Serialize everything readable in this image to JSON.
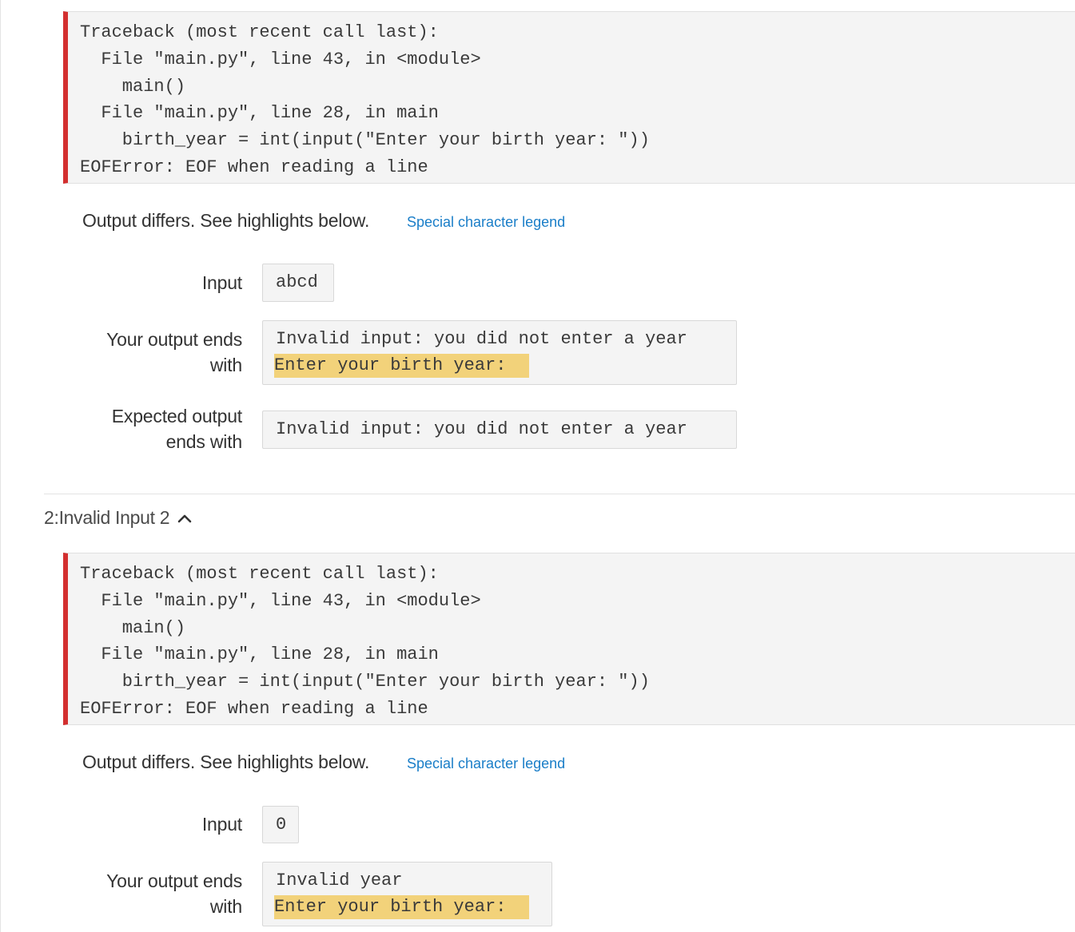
{
  "tests": [
    {
      "traceback": [
        "Traceback (most recent call last):",
        "  File \"main.py\", line 43, in <module>",
        "    main()",
        "  File \"main.py\", line 28, in main",
        "    birth_year = int(input(\"Enter your birth year: \"))",
        "EOFError: EOF when reading a line"
      ],
      "diff_message": "Output differs. See highlights below.",
      "legend_link": "Special character legend",
      "input_label": "Input",
      "input_value": "abcd",
      "your_output_label_1": "Your output ends",
      "your_output_label_2": "with",
      "your_output_lines": [
        "Invalid input: you did not enter a year"
      ],
      "your_output_highlight": "Enter your birth year: ",
      "expected_label_1": "Expected output",
      "expected_label_2": "ends with",
      "expected_lines": [
        "Invalid input: you did not enter a year"
      ]
    },
    {
      "section_title": "2:Invalid Input 2",
      "traceback": [
        "Traceback (most recent call last):",
        "  File \"main.py\", line 43, in <module>",
        "    main()",
        "  File \"main.py\", line 28, in main",
        "    birth_year = int(input(\"Enter your birth year: \"))",
        "EOFError: EOF when reading a line"
      ],
      "diff_message": "Output differs. See highlights below.",
      "legend_link": "Special character legend",
      "input_label": "Input",
      "input_value": "0",
      "your_output_label_1": "Your output ends",
      "your_output_label_2": "with",
      "your_output_lines": [
        "Invalid year"
      ],
      "your_output_highlight": "Enter your birth year: "
    }
  ],
  "colors": {
    "error_border": "#d32f2f",
    "highlight": "#f2d27a",
    "link": "#1a7ec8"
  }
}
